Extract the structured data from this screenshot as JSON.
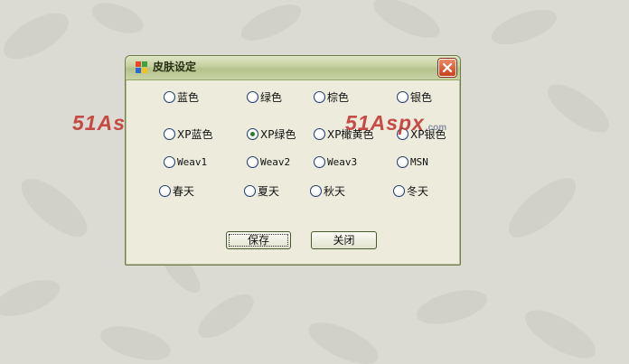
{
  "window": {
    "title": "皮肤设定",
    "close_symbol": "×"
  },
  "skins": {
    "row1": [
      "蓝色",
      "绿色",
      "棕色",
      "银色"
    ],
    "row2": [
      "XP蓝色",
      "XP绿色",
      "XP橄黄色",
      "XP银色"
    ],
    "row3": [
      "Weav1",
      "Weav2",
      "Weav3",
      "MSN"
    ],
    "row4": [
      "春天",
      "夏天",
      "秋天",
      "冬天"
    ],
    "selected": "XP绿色"
  },
  "buttons": {
    "save": "保存",
    "close": "关闭"
  },
  "watermark": {
    "main": "51Aspx",
    "sub": ".com"
  },
  "icons": {
    "app": "windows-logo-icon",
    "close": "close-icon"
  },
  "colors": {
    "titlebar": "#c3cf9e",
    "close_button": "#c8421b",
    "window_bg": "#ecebdc",
    "watermark": "#c33a35"
  }
}
